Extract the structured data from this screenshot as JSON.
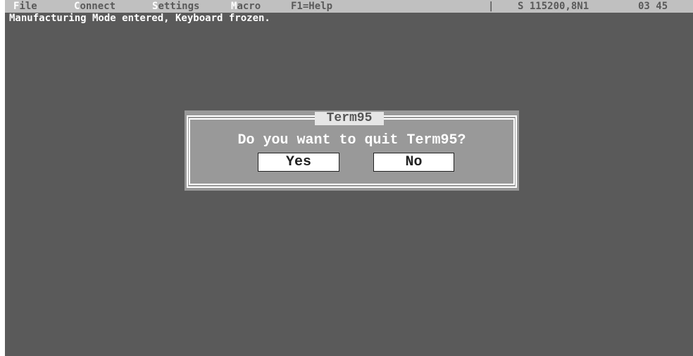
{
  "menubar": {
    "items": [
      {
        "hot": "F",
        "rest": "ile"
      },
      {
        "hot": "C",
        "rest": "onnect"
      },
      {
        "hot": "S",
        "rest": "ettings"
      },
      {
        "hot": "M",
        "rest": "acro"
      }
    ],
    "help": "F1=Help",
    "separator": "|",
    "comm_settings": "S 115200,8N1",
    "clock": "03 45"
  },
  "terminal": {
    "line1": "Manufacturing Mode entered, Keyboard frozen."
  },
  "dialog": {
    "title": "Term95",
    "message": "Do you want to quit Term95?",
    "yes_label": "Yes",
    "no_label": "No"
  },
  "colors": {
    "screen_background": "#5a5a5a",
    "menubar_background": "#c0c0c0",
    "dialog_background": "#999999",
    "text_white": "#ffffff"
  }
}
